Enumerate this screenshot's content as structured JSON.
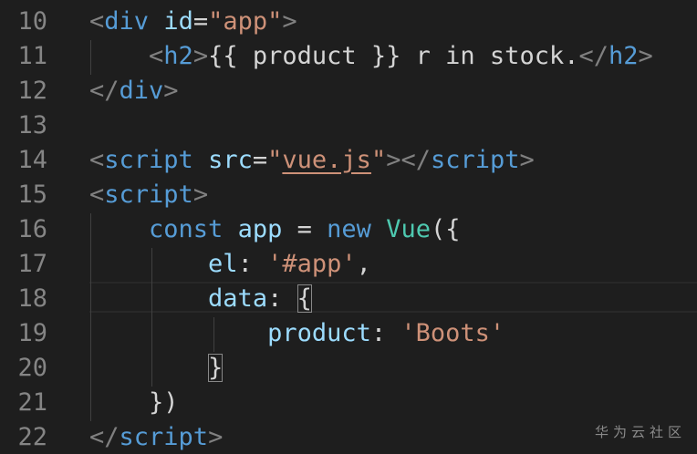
{
  "editor": {
    "lines": [
      {
        "number": "10",
        "tokens": [
          {
            "text": "<",
            "kind": "punct"
          },
          {
            "text": "div",
            "kind": "tag"
          },
          {
            "text": " ",
            "kind": "text"
          },
          {
            "text": "id",
            "kind": "attr"
          },
          {
            "text": "=",
            "kind": "text"
          },
          {
            "text": "\"app\"",
            "kind": "str"
          },
          {
            "text": ">",
            "kind": "punct"
          }
        ]
      },
      {
        "number": "11",
        "tokens": [
          {
            "text": "    ",
            "kind": "text"
          },
          {
            "text": "<",
            "kind": "punct"
          },
          {
            "text": "h2",
            "kind": "tag"
          },
          {
            "text": ">",
            "kind": "punct"
          },
          {
            "text": "{{ product }} r in stock.",
            "kind": "text"
          },
          {
            "text": "</",
            "kind": "punct"
          },
          {
            "text": "h2",
            "kind": "tag"
          },
          {
            "text": ">",
            "kind": "punct"
          }
        ]
      },
      {
        "number": "12",
        "tokens": [
          {
            "text": "</",
            "kind": "punct"
          },
          {
            "text": "div",
            "kind": "tag"
          },
          {
            "text": ">",
            "kind": "punct"
          }
        ]
      },
      {
        "number": "13",
        "tokens": []
      },
      {
        "number": "14",
        "tokens": [
          {
            "text": "<",
            "kind": "punct"
          },
          {
            "text": "script",
            "kind": "tag"
          },
          {
            "text": " ",
            "kind": "text"
          },
          {
            "text": "src",
            "kind": "attr"
          },
          {
            "text": "=",
            "kind": "text"
          },
          {
            "text": "\"",
            "kind": "str"
          },
          {
            "text": "vue.js",
            "kind": "link"
          },
          {
            "text": "\"",
            "kind": "str"
          },
          {
            "text": "></",
            "kind": "punct"
          },
          {
            "text": "script",
            "kind": "tag"
          },
          {
            "text": ">",
            "kind": "punct"
          }
        ]
      },
      {
        "number": "15",
        "tokens": [
          {
            "text": "<",
            "kind": "punct"
          },
          {
            "text": "script",
            "kind": "tag"
          },
          {
            "text": ">",
            "kind": "punct"
          }
        ]
      },
      {
        "number": "16",
        "tokens": [
          {
            "text": "    ",
            "kind": "text"
          },
          {
            "text": "const",
            "kind": "kw"
          },
          {
            "text": " ",
            "kind": "text"
          },
          {
            "text": "app",
            "kind": "var"
          },
          {
            "text": " = ",
            "kind": "text"
          },
          {
            "text": "new",
            "kind": "kw"
          },
          {
            "text": " ",
            "kind": "text"
          },
          {
            "text": "Vue",
            "kind": "cls"
          },
          {
            "text": "({",
            "kind": "text"
          }
        ]
      },
      {
        "number": "17",
        "tokens": [
          {
            "text": "        ",
            "kind": "text"
          },
          {
            "text": "el",
            "kind": "var"
          },
          {
            "text": ": ",
            "kind": "text"
          },
          {
            "text": "'#app'",
            "kind": "str"
          },
          {
            "text": ",",
            "kind": "text"
          }
        ]
      },
      {
        "number": "18",
        "tokens": [
          {
            "text": "        ",
            "kind": "text"
          },
          {
            "text": "data",
            "kind": "var"
          },
          {
            "text": ": ",
            "kind": "text"
          },
          {
            "text": "{",
            "kind": "bracket"
          }
        ]
      },
      {
        "number": "19",
        "tokens": [
          {
            "text": "            ",
            "kind": "text"
          },
          {
            "text": "product",
            "kind": "var"
          },
          {
            "text": ": ",
            "kind": "text"
          },
          {
            "text": "'Boots'",
            "kind": "str"
          }
        ]
      },
      {
        "number": "20",
        "tokens": [
          {
            "text": "        ",
            "kind": "text"
          },
          {
            "text": "}",
            "kind": "bracket"
          }
        ]
      },
      {
        "number": "21",
        "tokens": [
          {
            "text": "    ",
            "kind": "text"
          },
          {
            "text": "})",
            "kind": "text"
          }
        ]
      },
      {
        "number": "22",
        "tokens": [
          {
            "text": "</",
            "kind": "punct"
          },
          {
            "text": "script",
            "kind": "tag"
          },
          {
            "text": ">",
            "kind": "punct"
          }
        ]
      }
    ]
  },
  "watermark": {
    "text": "华为云社区"
  },
  "colors": {
    "background": "#1e1e1e",
    "line_number": "#858585",
    "tag": "#569cd6",
    "attribute": "#9cdcfe",
    "string": "#ce9178",
    "class": "#4ec9b0",
    "punctuation": "#808080",
    "text": "#d4d4d4"
  }
}
